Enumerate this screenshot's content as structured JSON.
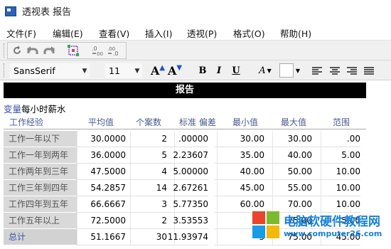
{
  "window": {
    "title": "透视表 报告"
  },
  "menu": [
    "文件(F)",
    "编辑(E)",
    "查看(V)",
    "插入(I)",
    "透视(P)",
    "格式(O)",
    "帮助(H)"
  ],
  "toolbar": {
    "icons": [
      "undo-icon",
      "undo-back-icon",
      "redo-icon",
      "pivot-icon",
      "decrease-decimal-icon",
      "increase-decimal-icon"
    ]
  },
  "format": {
    "font_family": "SansSerif",
    "font_size": "11",
    "grow_font": "A",
    "shrink_font": "A",
    "bold": "B",
    "italic": "I",
    "underline": "U",
    "text_color": "A"
  },
  "report": {
    "title": "报告",
    "variable_label": "变量",
    "variable_name": "每小时薪水",
    "columns": [
      "工作经验",
      "平均值",
      "个案数",
      "标准 偏差",
      "最小值",
      "最大值",
      "范围"
    ],
    "rows": [
      {
        "label": "工作一年以下",
        "mean": "30.0000",
        "n": "2",
        "sd": ".00000",
        "min": "30.00",
        "max": "30.00",
        "range": ".00"
      },
      {
        "label": "工作一年到两年",
        "mean": "36.0000",
        "n": "5",
        "sd": "2.23607",
        "min": "35.00",
        "max": "40.00",
        "range": "5.00"
      },
      {
        "label": "工作两年到三年",
        "mean": "47.5000",
        "n": "4",
        "sd": "5.00000",
        "min": "40.00",
        "max": "50.00",
        "range": "10.00"
      },
      {
        "label": "工作三年到四年",
        "mean": "54.2857",
        "n": "14",
        "sd": "2.67261",
        "min": "45.00",
        "max": "55.00",
        "range": "10.00"
      },
      {
        "label": "工作四年到五年",
        "mean": "66.6667",
        "n": "3",
        "sd": "5.77350",
        "min": "60.00",
        "max": "70.00",
        "range": "10.00"
      },
      {
        "label": "工作五年以上",
        "mean": "72.5000",
        "n": "2",
        "sd": "3.53553",
        "min": "7",
        "max": "75.00",
        "range": "5.00"
      },
      {
        "label": "总计",
        "mean": "51.1667",
        "n": "30",
        "sd": "11.93974",
        "min": "3",
        "max": "75.00",
        "range": "45.00"
      }
    ]
  },
  "watermark": {
    "title": "电脑软硬件教程网",
    "url": "www.computer26.com"
  },
  "colors": {
    "report_bar": "#000000",
    "header_text": "#4a5a90",
    "label_bg": "#d9d9d9",
    "watermark": "#1a82d8"
  }
}
